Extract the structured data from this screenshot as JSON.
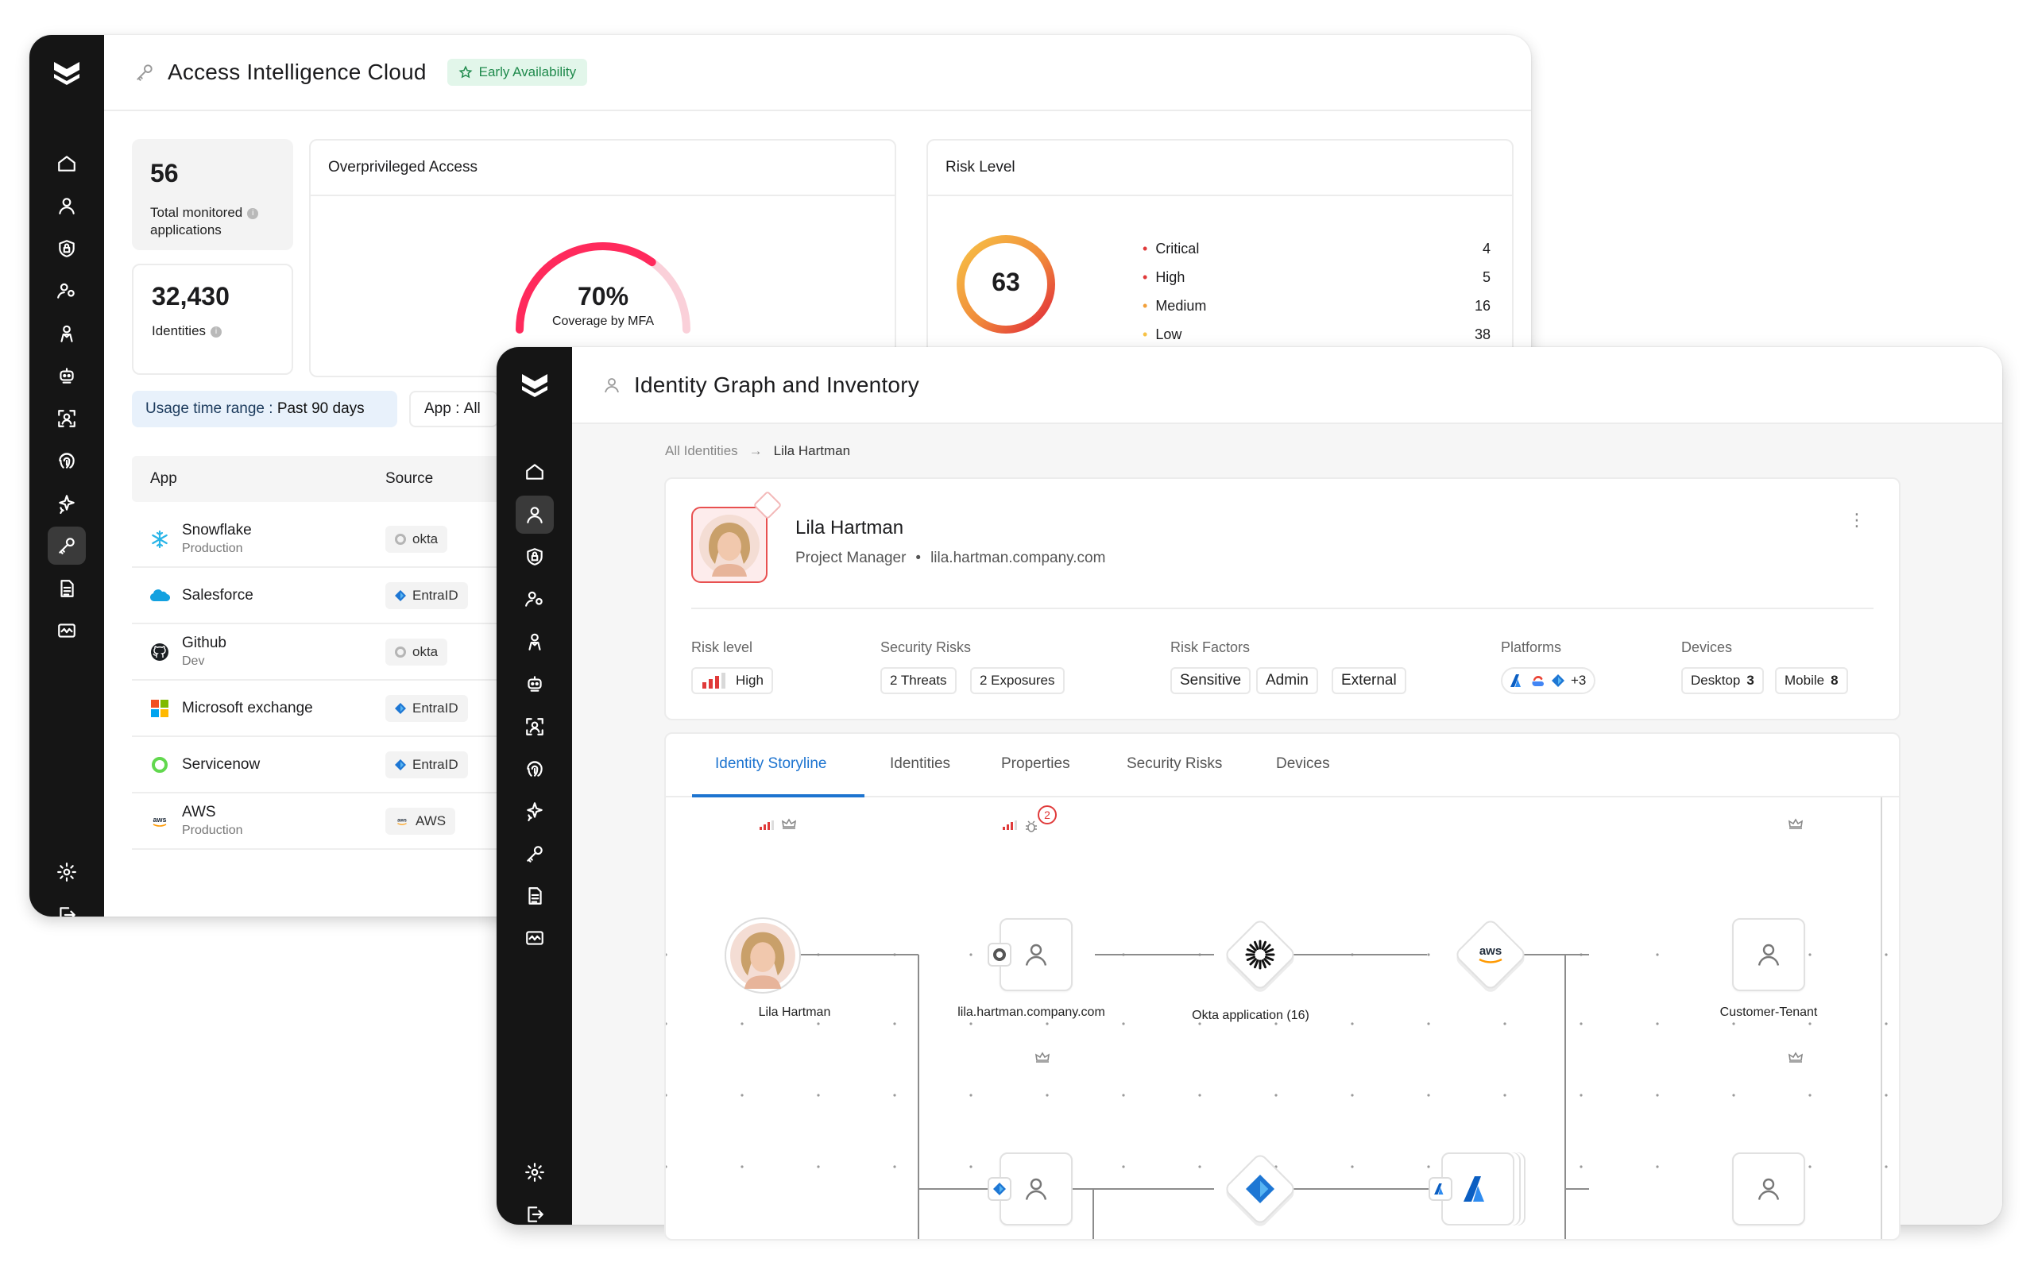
{
  "colors": {
    "rail": "#151515",
    "accent": "#1d74d0",
    "critical": "#e03a3a",
    "high": "#e03a3a",
    "medium": "#f2a03a",
    "low": "#f7c246",
    "green": "#1f8a4c"
  },
  "back_window": {
    "title": "Access Intelligence Cloud",
    "title_icon": "key-icon",
    "badge": "Early Availability",
    "stats": [
      {
        "value": "56",
        "label_line1": "Total monitored",
        "label_line2": "applications"
      },
      {
        "value": "32,430",
        "label": "Identities"
      }
    ],
    "overprivileged": {
      "title": "Overprivileged Access",
      "value": "70%",
      "caption": "Coverage by MFA",
      "fraction": 0.7
    },
    "risk_level": {
      "title": "Risk Level",
      "score": "63",
      "rows": [
        {
          "label": "Critical",
          "value": "4"
        },
        {
          "label": "High",
          "value": "5"
        },
        {
          "label": "Medium",
          "value": "16"
        },
        {
          "label": "Low",
          "value": "38"
        }
      ]
    },
    "filters": {
      "time_label": "Usage time range :",
      "time_value": "Past 90 days",
      "app_label": "App :",
      "app_value": "All"
    },
    "table": {
      "headers": [
        "App",
        "Source"
      ],
      "rows": [
        {
          "name": "Snowflake",
          "sub": "Production",
          "source": "okta",
          "icon": "snowflake-icon",
          "source_icon": "okta-icon"
        },
        {
          "name": "Salesforce",
          "sub": "",
          "source": "EntraID",
          "icon": "salesforce-icon",
          "source_icon": "entra-icon"
        },
        {
          "name": "Github",
          "sub": "Dev",
          "source": "okta",
          "icon": "github-icon",
          "source_icon": "okta-icon"
        },
        {
          "name": "Microsoft exchange",
          "sub": "",
          "source": "EntraID",
          "icon": "microsoft-icon",
          "source_icon": "entra-icon"
        },
        {
          "name": "Servicenow",
          "sub": "",
          "source": "EntraID",
          "icon": "servicenow-icon",
          "source_icon": "entra-icon"
        },
        {
          "name": "AWS",
          "sub": "Production",
          "source": "AWS",
          "icon": "aws-icon",
          "source_icon": "aws-icon"
        }
      ]
    }
  },
  "front_window": {
    "title": "Identity Graph and Inventory",
    "title_icon": "user-icon",
    "breadcrumb": {
      "root": "All Identities",
      "current": "Lila Hartman"
    },
    "profile": {
      "name": "Lila Hartman",
      "role": "Project Manager",
      "domain": "lila.hartman.company.com",
      "risk_level_label": "Risk level",
      "risk_level": "High",
      "security_risks_label": "Security Risks",
      "threats": "2 Threats",
      "exposures": "2 Exposures",
      "risk_factors_label": "Risk Factors",
      "risk_factors": [
        "Sensitive",
        "Admin",
        "External"
      ],
      "platforms_label": "Platforms",
      "platforms_more": "+3",
      "devices_label": "Devices",
      "desktop_label": "Desktop",
      "desktop_count": "3",
      "mobile_label": "Mobile",
      "mobile_count": "8"
    },
    "tabs": [
      "Identity Storyline",
      "Identities",
      "Properties",
      "Security Risks",
      "Devices"
    ],
    "active_tab": "Identity Storyline",
    "graph": {
      "nodes": [
        {
          "label": "Lila Hartman"
        },
        {
          "label": "lila.hartman.company.com",
          "badge": "2"
        },
        {
          "label": "Okta application (16)"
        },
        {
          "label": "aws"
        },
        {
          "label": "Customer-Tenant"
        }
      ]
    }
  }
}
